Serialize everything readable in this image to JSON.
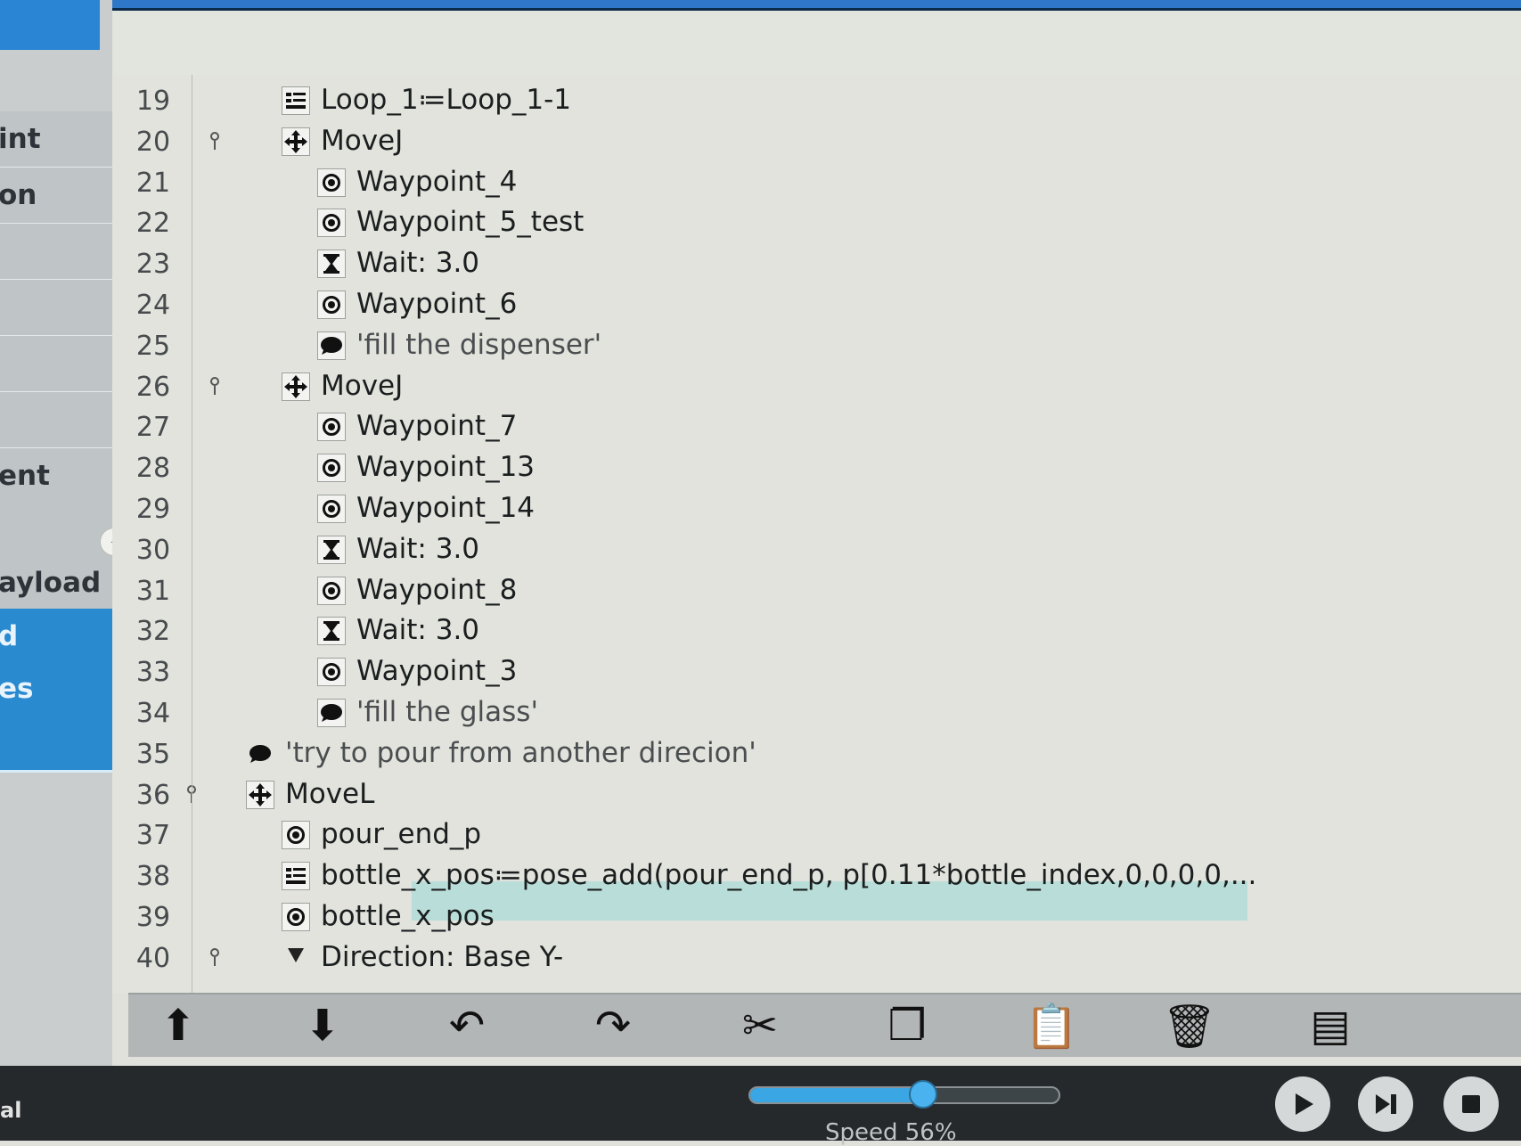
{
  "sidebar": {
    "items": [
      {
        "label": "int",
        "active": false
      },
      {
        "label": "on",
        "active": false
      },
      {
        "label": "",
        "active": false
      },
      {
        "label": "",
        "active": false
      },
      {
        "label": "",
        "active": false
      },
      {
        "label": "",
        "active": false
      },
      {
        "label": "ent",
        "active": false
      },
      {
        "label": "",
        "active": false
      },
      {
        "label": "ayload",
        "active": false
      },
      {
        "label": "d",
        "active": true
      },
      {
        "label": "es",
        "active": true
      },
      {
        "label": "",
        "active": true
      }
    ],
    "collapse_glyph": "◂"
  },
  "program": {
    "highlight_line": 38,
    "rows": [
      {
        "line": "19",
        "indent": 1,
        "icon": "assignment-icon",
        "text": "Loop_1≔Loop_1-1"
      },
      {
        "line": "20",
        "indent": 1,
        "icon": "move-icon",
        "text": "MoveJ",
        "pin": true
      },
      {
        "line": "21",
        "indent": 2,
        "icon": "waypoint-icon",
        "text": "Waypoint_4"
      },
      {
        "line": "22",
        "indent": 2,
        "icon": "waypoint-icon",
        "text": "Waypoint_5_test"
      },
      {
        "line": "23",
        "indent": 2,
        "icon": "wait-icon",
        "text": "Wait: 3.0"
      },
      {
        "line": "24",
        "indent": 2,
        "icon": "waypoint-icon",
        "text": "Waypoint_6"
      },
      {
        "line": "25",
        "indent": 2,
        "icon": "comment-icon",
        "text": "'fill the dispenser'",
        "comment": true
      },
      {
        "line": "26",
        "indent": 1,
        "icon": "move-icon",
        "text": "MoveJ",
        "pin": true
      },
      {
        "line": "27",
        "indent": 2,
        "icon": "waypoint-icon",
        "text": "Waypoint_7"
      },
      {
        "line": "28",
        "indent": 2,
        "icon": "waypoint-icon",
        "text": "Waypoint_13"
      },
      {
        "line": "29",
        "indent": 2,
        "icon": "waypoint-icon",
        "text": "Waypoint_14"
      },
      {
        "line": "30",
        "indent": 2,
        "icon": "wait-icon",
        "text": "Wait: 3.0"
      },
      {
        "line": "31",
        "indent": 2,
        "icon": "waypoint-icon",
        "text": "Waypoint_8"
      },
      {
        "line": "32",
        "indent": 2,
        "icon": "wait-icon",
        "text": "Wait: 3.0"
      },
      {
        "line": "33",
        "indent": 2,
        "icon": "waypoint-icon",
        "text": "Waypoint_3"
      },
      {
        "line": "34",
        "indent": 2,
        "icon": "comment-icon",
        "text": "'fill the glass'",
        "comment": true
      },
      {
        "line": "35",
        "indent": 0,
        "icon": "comment-icon",
        "text": "'try to pour from another direcion'",
        "comment": true
      },
      {
        "line": "36",
        "indent": 0,
        "icon": "move-icon",
        "text": "MoveL",
        "pin": true
      },
      {
        "line": "37",
        "indent": 1,
        "icon": "waypoint-icon",
        "text": "pour_end_p"
      },
      {
        "line": "38",
        "indent": 1,
        "icon": "assignment-icon",
        "text": "bottle_x_pos≔pose_add(pour_end_p, p[0.11*bottle_index,0,0,0,0,..."
      },
      {
        "line": "39",
        "indent": 1,
        "icon": "waypoint-icon",
        "text": "bottle_x_pos"
      },
      {
        "line": "40",
        "indent": 1,
        "icon": "direction-icon",
        "text": "Direction: Base Y-",
        "pin": true
      }
    ]
  },
  "toolbar": {
    "buttons": [
      {
        "name": "move-up-button",
        "icon": "arrow-up-icon",
        "glyph": "⬆"
      },
      {
        "name": "move-down-button",
        "icon": "arrow-down-icon",
        "glyph": "⬇"
      },
      {
        "name": "undo-button",
        "icon": "undo-icon",
        "glyph": "↶"
      },
      {
        "name": "redo-button",
        "icon": "redo-icon",
        "glyph": "↷"
      },
      {
        "name": "cut-button",
        "icon": "scissors-icon",
        "glyph": "✂"
      },
      {
        "name": "copy-button",
        "icon": "copy-icon",
        "glyph": "❐"
      },
      {
        "name": "paste-button",
        "icon": "clipboard-icon",
        "glyph": "📋"
      },
      {
        "name": "delete-button",
        "icon": "trash-icon",
        "glyph": "🗑"
      },
      {
        "name": "suppress-button",
        "icon": "suppress-icon",
        "glyph": "▤"
      }
    ]
  },
  "bottom": {
    "left_text": "al",
    "speed_label": "Speed 56%",
    "speed_fraction": 0.56
  },
  "colors": {
    "sidebar_active": "#2a8ad0",
    "highlight": "#b9ded9",
    "slider_fill": "#3aa6e4"
  }
}
